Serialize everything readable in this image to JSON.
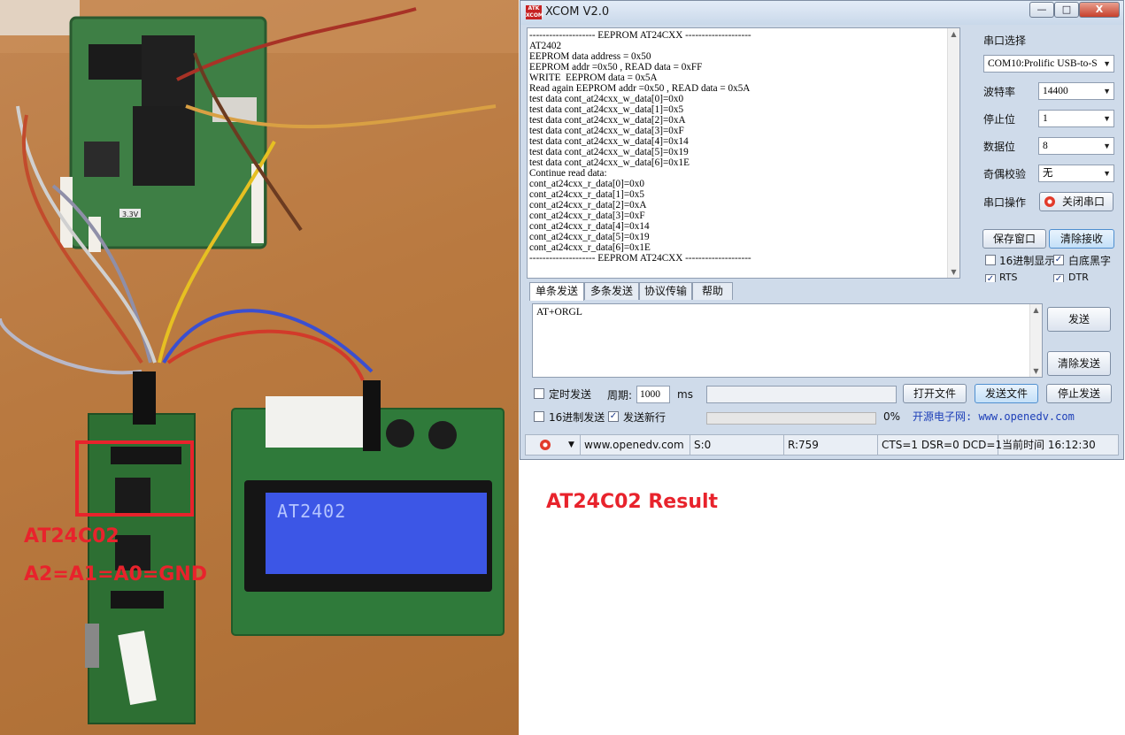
{
  "photo": {
    "annotation_chip": "AT24C02",
    "annotation_address": "A2=A1=A0=GND",
    "lcd_text": "AT2402",
    "board_label_3v3": "3.3V"
  },
  "caption": "AT24C02 Result",
  "window": {
    "title": "XCOM V2.0",
    "logo_text": "ATK XCOM",
    "minimize_label": "—",
    "maximize_label": "□",
    "close_label": "X"
  },
  "receive": {
    "lines": [
      "-------------------- EEPROM AT24CXX --------------------",
      "AT2402",
      "EEPROM data address = 0x50",
      "EEPROM addr =0x50 , READ data = 0xFF",
      "WRITE  EEPROM data = 0x5A",
      "Read again EEPROM addr =0x50 , READ data = 0x5A",
      "test data cont_at24cxx_w_data[0]=0x0",
      "test data cont_at24cxx_w_data[1]=0x5",
      "test data cont_at24cxx_w_data[2]=0xA",
      "test data cont_at24cxx_w_data[3]=0xF",
      "test data cont_at24cxx_w_data[4]=0x14",
      "test data cont_at24cxx_w_data[5]=0x19",
      "test data cont_at24cxx_w_data[6]=0x1E",
      "Continue read data:",
      "cont_at24cxx_r_data[0]=0x0",
      "cont_at24cxx_r_data[1]=0x5",
      "cont_at24cxx_r_data[2]=0xA",
      "cont_at24cxx_r_data[3]=0xF",
      "cont_at24cxx_r_data[4]=0x14",
      "cont_at24cxx_r_data[5]=0x19",
      "cont_at24cxx_r_data[6]=0x1E",
      "-------------------- EEPROM AT24CXX --------------------"
    ]
  },
  "settings": {
    "port_label": "串口选择",
    "port_value": "COM10:Prolific USB-to-S",
    "baud_label": "波特率",
    "baud_value": "14400",
    "stopbits_label": "停止位",
    "stopbits_value": "1",
    "databits_label": "数据位",
    "databits_value": "8",
    "parity_label": "奇偶校验",
    "parity_value": "无",
    "op_label": "串口操作",
    "close_port_button": "关闭串口",
    "save_window_button": "保存窗口",
    "clear_receive_button": "清除接收",
    "hex_display_label": "16进制显示",
    "hex_display_checked": false,
    "white_bg_label": "白底黑字",
    "white_bg_checked": true,
    "rts_label": "RTS",
    "rts_checked": true,
    "dtr_label": "DTR",
    "dtr_checked": true
  },
  "tabs": [
    "单条发送",
    "多条发送",
    "协议传输",
    "帮助"
  ],
  "send": {
    "text": "AT+ORGL",
    "send_button": "发送",
    "clear_send_button": "清除发送",
    "timed_send_label": "定时发送",
    "timed_send_checked": false,
    "period_label": "周期:",
    "period_value": "1000",
    "period_unit": "ms",
    "open_file_button": "打开文件",
    "send_file_button": "发送文件",
    "stop_send_button": "停止发送",
    "hex_send_label": "16进制发送",
    "hex_send_checked": false,
    "newline_label": "发送新行",
    "newline_checked": true,
    "progress_percent": 0,
    "progress_text": "0%",
    "site_text": "开源电子网: www.openedv.com"
  },
  "status": {
    "url": "www.openedv.com",
    "sent": "S:0",
    "received": "R:759",
    "lines": "CTS=1 DSR=0 DCD=1",
    "time": "当前时间 16:12:30"
  },
  "colors": {
    "annotation_red": "#e8232c",
    "lcd_blue": "#3c56e6",
    "pcb_green": "#2f7a3a",
    "window_bg": "#cfdbea"
  }
}
